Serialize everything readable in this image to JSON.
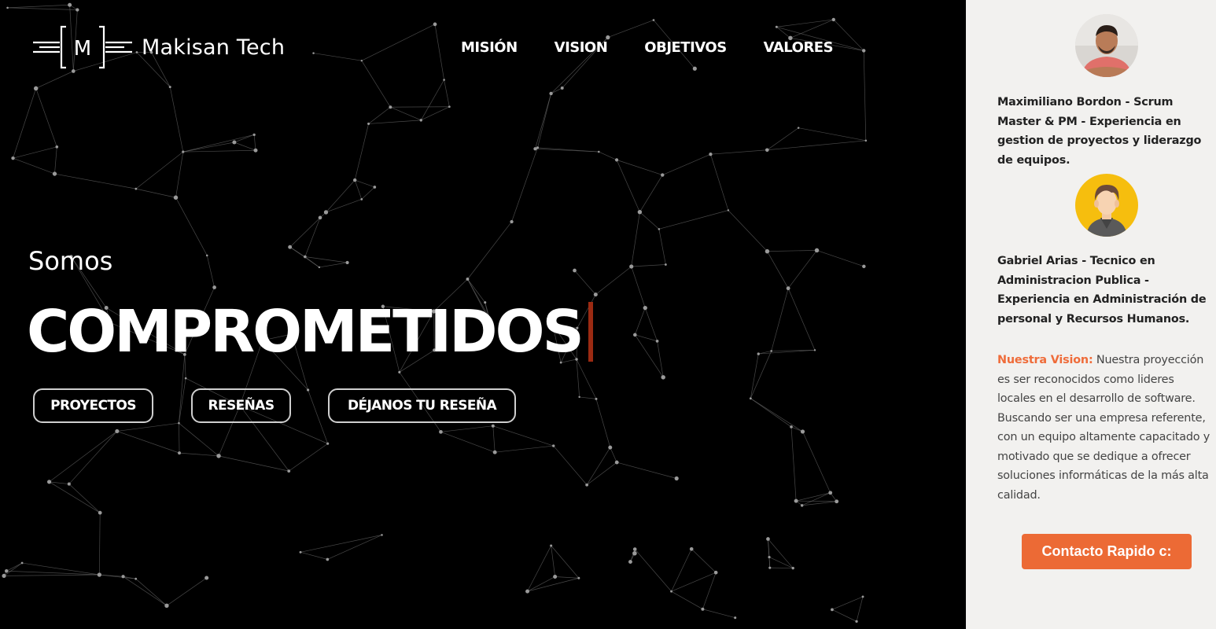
{
  "brand": {
    "name": "Makisan Tech",
    "logo_letter": "M"
  },
  "nav": {
    "items": [
      "MISIÓN",
      "VISION",
      "OBJETIVOS",
      "VALORES"
    ]
  },
  "hero": {
    "intro": "Somos",
    "headline": "COMPROMETIDOS",
    "buttons": [
      "PROYECTOS",
      "RESEÑAS",
      "DÉJANOS TU RESEÑA"
    ]
  },
  "sidebar": {
    "members": [
      {
        "avatar_icon": "person-photo-icon",
        "bio": "Maximiliano Bordon - Scrum Master & PM - Experiencia en gestion de proyectos y liderazgo de equipos."
      },
      {
        "avatar_icon": "person-avatar-icon",
        "bio": "Gabriel Arias - Tecnico en Administracion Publica - Experiencia en Administración de personal y Recursos Humanos."
      }
    ],
    "vision": {
      "label": "Nuestra Vision:",
      "text": " Nuestra proyección es ser reconocidos como lideres locales en el desarrollo de software. Buscando ser una empresa referente, con un equipo altamente capacitado y motivado que se dedique a ofrecer soluciones informáticas de la más alta calidad."
    },
    "contact_button": "Contacto Rapido c:"
  },
  "colors": {
    "hero_background": "#000000",
    "sidebar_background": "#f2f1ef",
    "accent": "#ec6a35",
    "cursor": "#9b2a12"
  }
}
